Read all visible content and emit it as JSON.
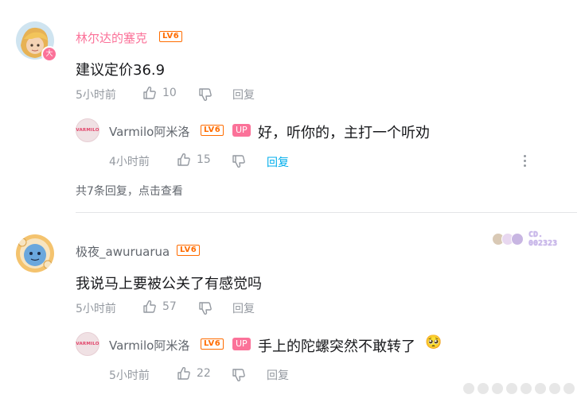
{
  "comments": [
    {
      "user": "林尔达的塞克",
      "level": "LV6",
      "avatar_badge": "大",
      "text": "建议定价36.9",
      "time": "5小时前",
      "likes": "10",
      "reply_label": "回复",
      "sub_reply": {
        "avatar_text": "VARMILO",
        "user": "Varmilo阿米洛",
        "level": "LV6",
        "up_tag": "UP",
        "text": "好，听你的，主打一个听劝",
        "time": "4小时前",
        "likes": "15",
        "reply_label": "回复"
      },
      "view_more": "共7条回复，点击查看"
    },
    {
      "user": "极夜_awuruarua",
      "level": "LV6",
      "fan_badge": "CD.\n002323",
      "text": "我说马上要被公关了有感觉吗",
      "time": "5小时前",
      "likes": "57",
      "reply_label": "回复",
      "sub_reply": {
        "avatar_text": "VARMILO",
        "user": "Varmilo阿米洛",
        "level": "LV6",
        "up_tag": "UP",
        "text": "手上的陀螺突然不敢转了",
        "emoji": "🥺",
        "time": "5小时前",
        "likes": "22",
        "reply_label": "回复"
      }
    }
  ],
  "colors": {
    "pink": "#fb7299",
    "level": "#ff6c00",
    "blue_link": "#00aeec",
    "meta_gray": "#9499a0"
  }
}
